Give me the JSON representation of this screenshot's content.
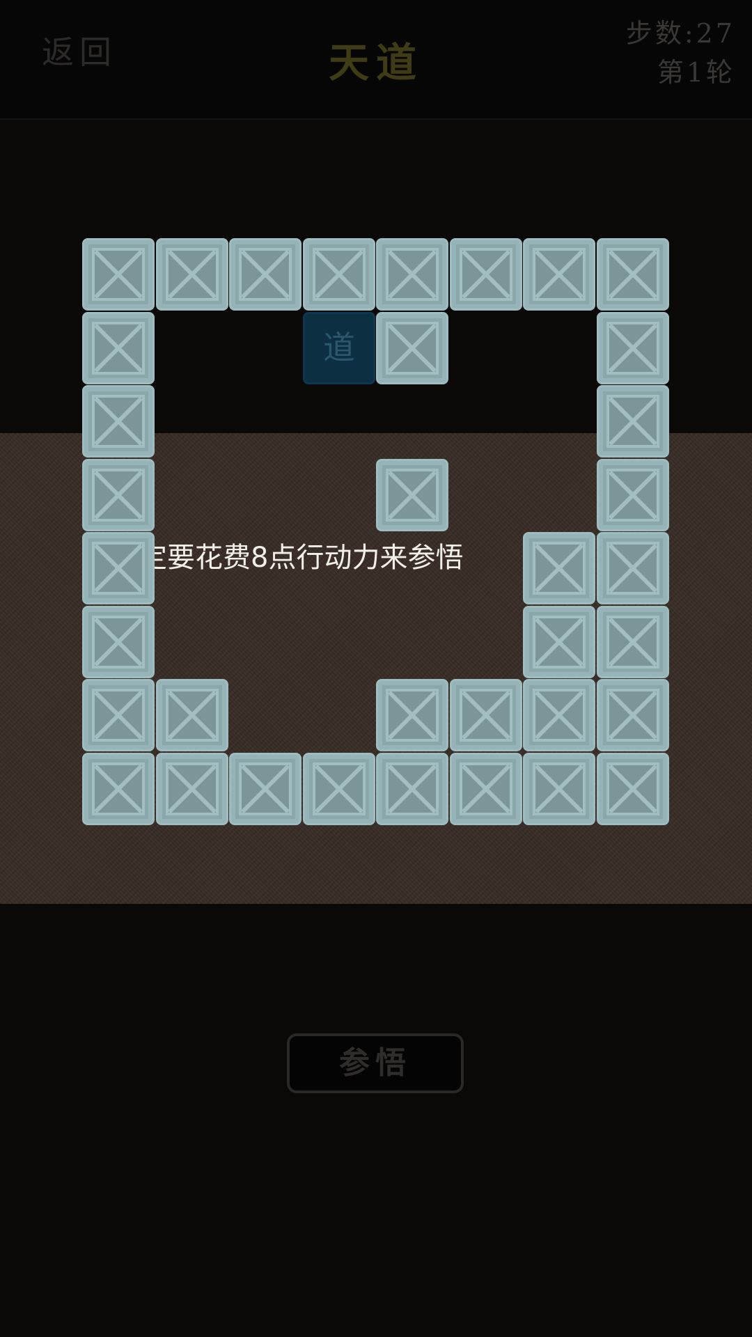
{
  "header": {
    "back_label": "返回",
    "title": "天道",
    "steps_label": "步数:27",
    "round_label": "第1轮"
  },
  "dialog": {
    "message": "定要花费8点行动力来参悟"
  },
  "board": {
    "rows": 8,
    "cols": 8,
    "dao_char": "道",
    "dao_cell": [
      1,
      3
    ],
    "tile_icon": "crossed-box-icon",
    "tiles": [
      [
        0,
        0
      ],
      [
        0,
        1
      ],
      [
        0,
        2
      ],
      [
        0,
        3
      ],
      [
        0,
        4
      ],
      [
        0,
        5
      ],
      [
        0,
        6
      ],
      [
        0,
        7
      ],
      [
        1,
        0
      ],
      [
        1,
        4
      ],
      [
        1,
        7
      ],
      [
        2,
        0
      ],
      [
        2,
        7
      ],
      [
        3,
        0
      ],
      [
        3,
        4
      ],
      [
        3,
        7
      ],
      [
        4,
        0
      ],
      [
        4,
        6
      ],
      [
        4,
        7
      ],
      [
        5,
        0
      ],
      [
        5,
        6
      ],
      [
        5,
        7
      ],
      [
        6,
        0
      ],
      [
        6,
        1
      ],
      [
        6,
        4
      ],
      [
        6,
        5
      ],
      [
        6,
        6
      ],
      [
        6,
        7
      ],
      [
        7,
        0
      ],
      [
        7,
        1
      ],
      [
        7,
        2
      ],
      [
        7,
        3
      ],
      [
        7,
        4
      ],
      [
        7,
        5
      ],
      [
        7,
        6
      ],
      [
        7,
        7
      ]
    ]
  },
  "footer": {
    "comprehend_label": "参悟"
  },
  "colors": {
    "tile": "#8aa8ab",
    "tile_border": "#9fbdc0",
    "dao_tile": "#0c2f41",
    "band": "#3a2e27",
    "title": "#3f3b14"
  }
}
